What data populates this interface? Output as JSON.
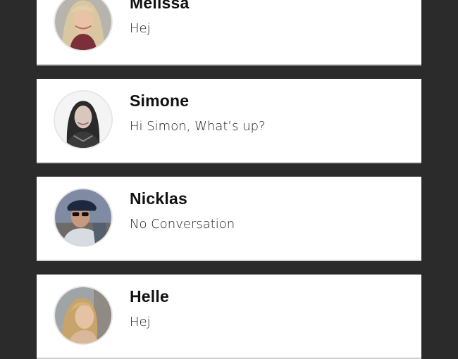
{
  "conversations": [
    {
      "name": "Melissa",
      "message": "Hej",
      "avatar": "melissa-avatar"
    },
    {
      "name": "Simone",
      "message": "Hi Simon, What’s up?",
      "avatar": "simone-avatar"
    },
    {
      "name": "Nicklas",
      "message": "No Conversation",
      "avatar": "nicklas-avatar"
    },
    {
      "name": "Helle",
      "message": "Hej",
      "avatar": "helle-avatar"
    }
  ],
  "colors": {
    "background": "#2b2b2b",
    "card": "#ffffff",
    "divider": "#cfcfcf"
  }
}
